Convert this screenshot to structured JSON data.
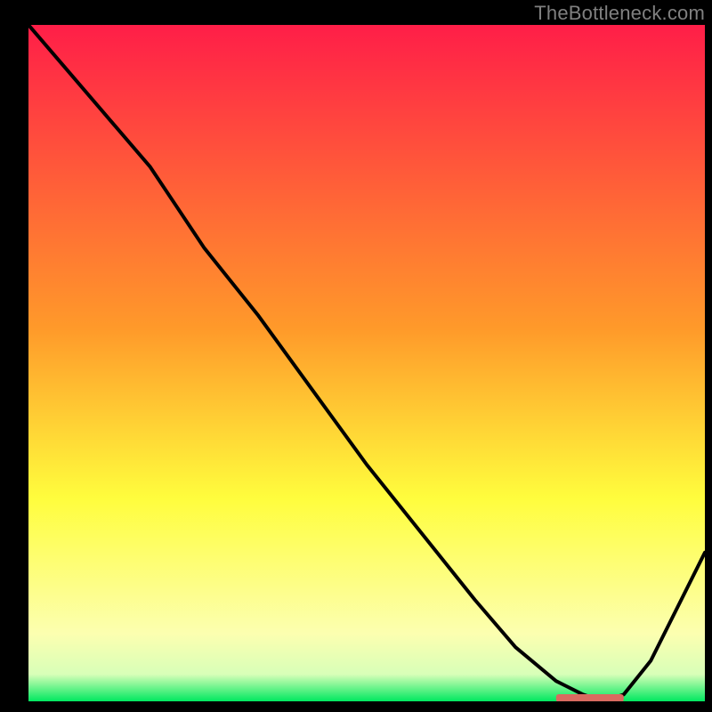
{
  "watermark": "TheBottleneck.com",
  "colors": {
    "top": "#ff1e48",
    "mid1": "#ff7a2a",
    "mid2": "#fffd3d",
    "pale": "#fcffb0",
    "green": "#00e860",
    "line": "#000000"
  },
  "chart_data": {
    "type": "line",
    "title": "",
    "xlabel": "",
    "ylabel": "",
    "xlim": [
      0,
      100
    ],
    "ylim": [
      0,
      100
    ],
    "grid": false,
    "legend": null,
    "notch_label": "",
    "series": [
      {
        "name": "curve",
        "x": [
          0,
          6,
          12,
          18,
          22,
          26,
          34,
          42,
          50,
          58,
          66,
          72,
          78,
          82,
          85,
          88,
          92,
          96,
          100
        ],
        "y": [
          100,
          93,
          86,
          79,
          73,
          67,
          57,
          46,
          35,
          25,
          15,
          8,
          3,
          1,
          0,
          1,
          6,
          14,
          22
        ]
      }
    ]
  }
}
